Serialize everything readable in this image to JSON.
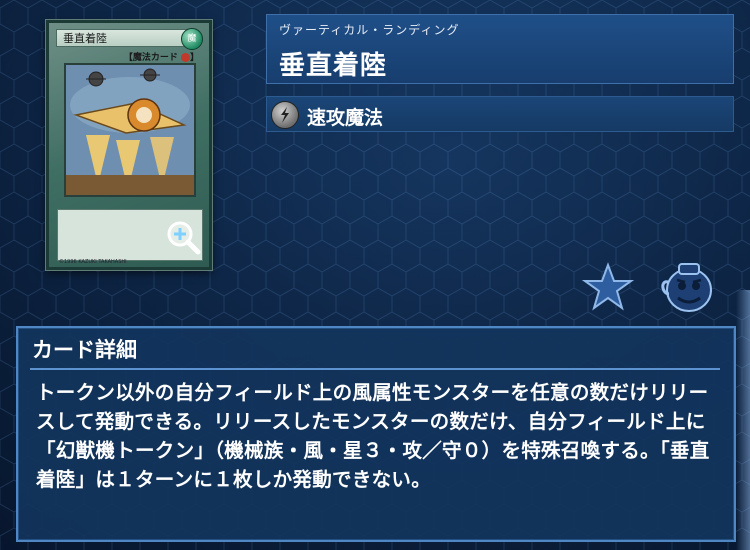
{
  "card": {
    "name": "垂直着陸",
    "attribute": "魔",
    "type_bracket": "【魔法カード",
    "footer": "©1996 KAZUKI TAKAHASHI"
  },
  "title": {
    "ruby": "ヴァーティカル・ランディング",
    "name": "垂直着陸"
  },
  "spell_type": {
    "label": "速攻魔法",
    "icon": "quick-play-icon"
  },
  "actions": {
    "favorite_icon": "star-icon",
    "jar_icon": "pot-icon",
    "zoom_icon": "magnify-plus-icon"
  },
  "detail": {
    "heading": "カード詳細",
    "text": "トークン以外の自分フィールド上の風属性モンスターを任意の数だけリリースして発動できる。リリースしたモンスターの数だけ、自分フィールド上に「幻獣機トークン」（機械族・風・星３・攻／守０）を特殊召喚する。「垂直着陸」は１ターンに１枚しか発動できない。"
  },
  "colors": {
    "background": "#0e2748",
    "panel": "#12345c",
    "panel_border": "#4f86c4",
    "title_bg": "#1f4f88",
    "star": "#2e5e9f",
    "card_frame": "#3f6e63"
  }
}
